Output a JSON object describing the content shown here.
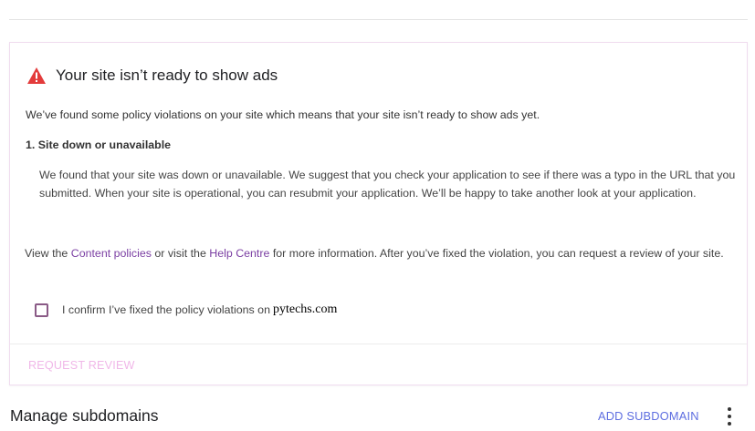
{
  "card": {
    "title": "Your site isn’t ready to show ads",
    "intro": "We’ve found some policy violations on your site which means that your site isn’t ready to show ads yet.",
    "issue": {
      "heading": "1. Site down or unavailable",
      "body": "We found that your site was down or unavailable. We suggest that you check your application to see if there was a typo in the URL that you submitted. When your site is operational, you can resubmit your application. We’ll be happy to take another look at your application."
    },
    "policy_note": {
      "prefix": "View the ",
      "content_policies_link": "Content policies",
      "middle": " or visit the ",
      "help_centre_link": "Help Centre",
      "suffix": " for more information. After you’ve fixed the violation, you can request a review of your site."
    },
    "confirm": {
      "label": "I confirm I’ve fixed the policy violations on",
      "site": "pytechs.com",
      "checked": false
    },
    "request_review_label": "REQUEST REVIEW"
  },
  "subdomains": {
    "title": "Manage subdomains",
    "add_label": "ADD SUBDOMAIN"
  },
  "colors": {
    "warning": "#e33b3b",
    "link": "#7b3fa3",
    "accent": "#5e6ee0",
    "disabled_button": "#f0b7e8"
  },
  "icons": {
    "warning": "warning-icon",
    "more": "more-vert-icon"
  }
}
